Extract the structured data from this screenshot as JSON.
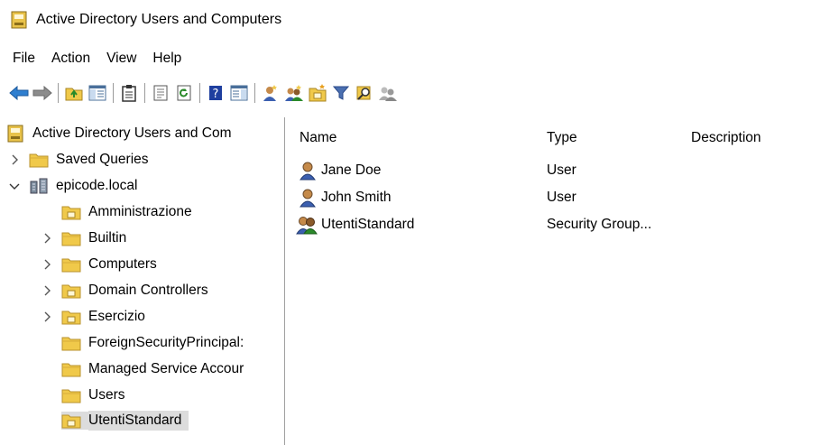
{
  "window": {
    "title": "Active Directory Users and Computers"
  },
  "menu": [
    "File",
    "Action",
    "View",
    "Help"
  ],
  "toolbar_icons": [
    "back-arrow-icon",
    "forward-arrow-icon",
    "up-folder-icon",
    "show-console-tree-icon",
    "clipboard-icon",
    "properties-icon",
    "refresh-icon",
    "help-icon",
    "show-action-pane-icon",
    "new-user-icon",
    "new-group-icon",
    "new-ou-icon",
    "filter-icon",
    "find-icon",
    "add-to-group-icon"
  ],
  "tree": [
    {
      "label": "Active Directory Users and Com",
      "level": 0,
      "chevron": "none",
      "icon": "root"
    },
    {
      "label": "Saved Queries",
      "level": 0,
      "chevron": "right",
      "icon": "folder"
    },
    {
      "label": "epicode.local",
      "level": 0,
      "chevron": "down",
      "icon": "domain"
    },
    {
      "label": "Amministrazione",
      "level": 1,
      "chevron": "none",
      "icon": "ou"
    },
    {
      "label": "Builtin",
      "level": 1,
      "chevron": "right",
      "icon": "folder"
    },
    {
      "label": "Computers",
      "level": 1,
      "chevron": "right",
      "icon": "folder"
    },
    {
      "label": "Domain Controllers",
      "level": 1,
      "chevron": "right",
      "icon": "ou"
    },
    {
      "label": "Esercizio",
      "level": 1,
      "chevron": "right",
      "icon": "ou"
    },
    {
      "label": "ForeignSecurityPrincipal:",
      "level": 1,
      "chevron": "none",
      "icon": "folder"
    },
    {
      "label": "Managed Service Accour",
      "level": 1,
      "chevron": "none",
      "icon": "folder"
    },
    {
      "label": "Users",
      "level": 1,
      "chevron": "none",
      "icon": "folder"
    },
    {
      "label": "UtentiStandard",
      "level": 1,
      "chevron": "none",
      "icon": "ou",
      "selected": true
    }
  ],
  "list": {
    "columns": [
      "Name",
      "Type",
      "Description"
    ],
    "rows": [
      {
        "name": "Jane Doe",
        "type": "User",
        "description": "",
        "icon": "user"
      },
      {
        "name": "John Smith",
        "type": "User",
        "description": "",
        "icon": "user"
      },
      {
        "name": "UtentiStandard",
        "type": "Security Group...",
        "description": "",
        "icon": "group"
      }
    ]
  },
  "colors": {
    "folder": "#f0c94a",
    "selection": "#dcdcdc",
    "arrow_blue": "#2f7fd0"
  }
}
